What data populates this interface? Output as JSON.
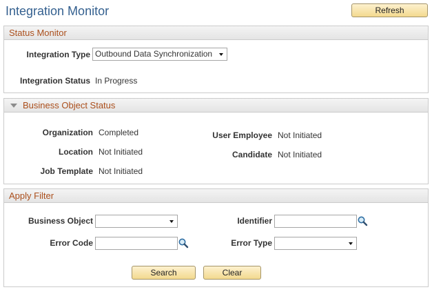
{
  "page": {
    "title": "Integration Monitor",
    "refresh_label": "Refresh"
  },
  "status_monitor": {
    "header": "Status Monitor",
    "integration_type_label": "Integration Type",
    "integration_type_value": "Outbound Data Synchronization",
    "integration_status_label": "Integration Status",
    "integration_status_value": "In Progress"
  },
  "business_object_status": {
    "header": "Business Object Status",
    "items": [
      {
        "label": "Organization",
        "value": "Completed"
      },
      {
        "label": "Location",
        "value": "Not Initiated"
      },
      {
        "label": "Job Template",
        "value": "Not Initiated"
      },
      {
        "label": "User Employee",
        "value": "Not Initiated"
      },
      {
        "label": "Candidate",
        "value": "Not Initiated"
      }
    ]
  },
  "apply_filter": {
    "header": "Apply Filter",
    "business_object_label": "Business Object",
    "business_object_value": "",
    "identifier_label": "Identifier",
    "identifier_value": "",
    "error_code_label": "Error Code",
    "error_code_value": "",
    "error_type_label": "Error Type",
    "error_type_value": "",
    "search_label": "Search",
    "clear_label": "Clear"
  },
  "colors": {
    "title": "#34608f",
    "section_header_text": "#ab4f1c",
    "button_top": "#fdf1cf",
    "button_bottom": "#f3d98e",
    "button_border": "#a49467"
  },
  "icons": {
    "lookup": "magnifier-icon",
    "collapse": "triangle-down-icon",
    "dropdown": "chevron-down-icon"
  }
}
